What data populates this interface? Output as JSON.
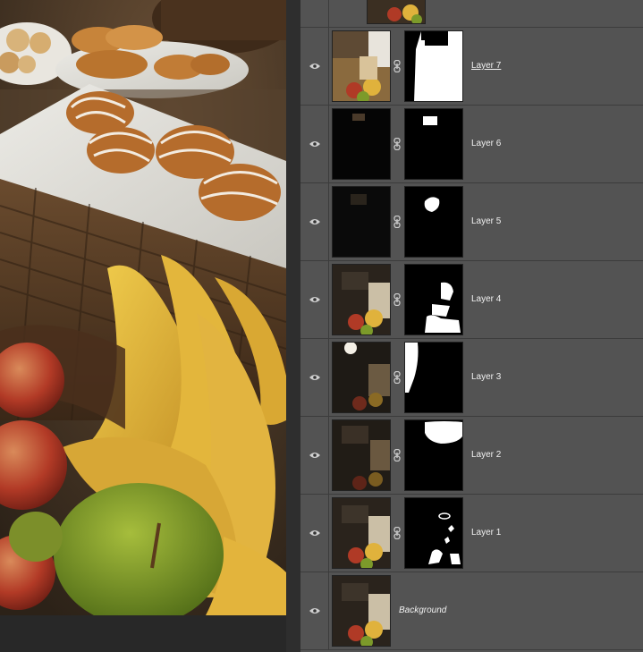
{
  "canvas": {
    "description_icon": "photo-canvas"
  },
  "layers": [
    {
      "name": "Layer 7",
      "style": "underline",
      "visible": true
    },
    {
      "name": "Layer 6",
      "style": "normal",
      "visible": true
    },
    {
      "name": "Layer 5",
      "style": "normal",
      "visible": true
    },
    {
      "name": "Layer 4",
      "style": "normal",
      "visible": true
    },
    {
      "name": "Layer 3",
      "style": "normal",
      "visible": true
    },
    {
      "name": "Layer 2",
      "style": "normal",
      "visible": true
    },
    {
      "name": "Layer 1",
      "style": "normal",
      "visible": true
    },
    {
      "name": "Background",
      "style": "italic",
      "visible": true
    }
  ],
  "icons": {
    "visibility": "eye-icon",
    "link": "chain-link-icon"
  },
  "colors": {
    "panel_bg": "#535353",
    "row_border": "#3c3c3c",
    "text": "#f0f0f0"
  }
}
